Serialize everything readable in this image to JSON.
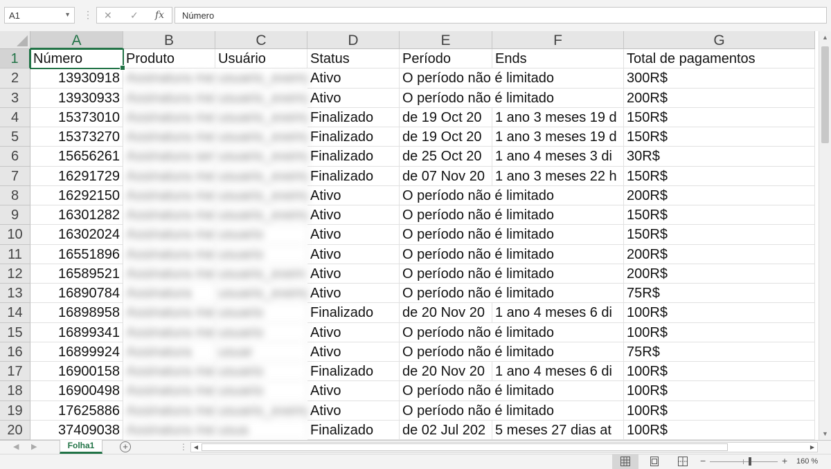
{
  "namebox": {
    "value": "A1"
  },
  "formula_bar": {
    "value": "Número",
    "cancel_symbol": "✕",
    "enter_symbol": "✓",
    "fx_label": "fx"
  },
  "columns": [
    "A",
    "B",
    "C",
    "D",
    "E",
    "F",
    "G"
  ],
  "rows": [
    {
      "n": "1",
      "a": "Número",
      "b": "Produto",
      "c": "Usuário",
      "d": "Status",
      "e": "Período",
      "f": "Ends",
      "g": "Total de pagamentos"
    },
    {
      "n": "2",
      "a": "13930918",
      "b": "Assinatura mensal plus",
      "c": "usuario_exemplo",
      "d": "Ativo",
      "e": "O período não é limitado",
      "f": "",
      "g": "300R$"
    },
    {
      "n": "3",
      "a": "13930933",
      "b": "Assinatura mensal plus",
      "c": "usuario_exemplo",
      "d": "Ativo",
      "e": "O período não é limitado",
      "f": "",
      "g": "200R$"
    },
    {
      "n": "4",
      "a": "15373010",
      "b": "Assinatura mensal",
      "c": "usuario_exemplo",
      "d": "Finalizado",
      "e": "de 19 Oct 20",
      "f": "1 ano 3 meses 19 d",
      "g": "150R$"
    },
    {
      "n": "5",
      "a": "15373270",
      "b": "Assinatura mensal",
      "c": "usuario_exemplo",
      "d": "Finalizado",
      "e": "de 19 Oct 20",
      "f": "1 ano 3 meses 19 d",
      "g": "150R$"
    },
    {
      "n": "6",
      "a": "15656261",
      "b": "Assinatura semanal",
      "c": "usuario_exemplo",
      "d": "Finalizado",
      "e": "de 25 Oct 20",
      "f": "1 ano 4 meses 3 di",
      "g": "30R$"
    },
    {
      "n": "7",
      "a": "16291729",
      "b": "Assinatura mensal",
      "c": "usuario_exemplo",
      "d": "Finalizado",
      "e": "de 07 Nov 20",
      "f": "1 ano 3 meses 22 h",
      "g": "150R$"
    },
    {
      "n": "8",
      "a": "16292150",
      "b": "Assinatura mensal plus",
      "c": "usuario_exemplo",
      "d": "Ativo",
      "e": "O período não é limitado",
      "f": "",
      "g": "200R$"
    },
    {
      "n": "9",
      "a": "16301282",
      "b": "Assinatura mensal",
      "c": "usuario_exemplo",
      "d": "Ativo",
      "e": "O período não é limitado",
      "f": "",
      "g": "150R$"
    },
    {
      "n": "10",
      "a": "16302024",
      "b": "Assinatura mensal",
      "c": "usuario",
      "d": "Ativo",
      "e": "O período não é limitado",
      "f": "",
      "g": "150R$"
    },
    {
      "n": "11",
      "a": "16551896",
      "b": "Assinatura mensal plus",
      "c": "usuario",
      "d": "Ativo",
      "e": "O período não é limitado",
      "f": "",
      "g": "200R$"
    },
    {
      "n": "12",
      "a": "16589521",
      "b": "Assinatura mensal plus",
      "c": "usuario_exem",
      "d": "Ativo",
      "e": "O período não é limitado",
      "f": "",
      "g": "200R$"
    },
    {
      "n": "13",
      "a": "16890784",
      "b": "Assinatura",
      "c": "usuario_exemplo",
      "d": "Ativo",
      "e": "O período não é limitado",
      "f": "",
      "g": "75R$"
    },
    {
      "n": "14",
      "a": "16898958",
      "b": "Assinatura mens",
      "c": "usuario",
      "d": "Finalizado",
      "e": "de 20 Nov 20",
      "f": "1 ano 4 meses 6 di",
      "g": "100R$"
    },
    {
      "n": "15",
      "a": "16899341",
      "b": "Assinatura mens",
      "c": "usuario",
      "d": "Ativo",
      "e": "O período não é limitado",
      "f": "",
      "g": "100R$"
    },
    {
      "n": "16",
      "a": "16899924",
      "b": "Assinatura",
      "c": "usuar",
      "d": "Ativo",
      "e": "O período não é limitado",
      "f": "",
      "g": "75R$"
    },
    {
      "n": "17",
      "a": "16900158",
      "b": "Assinatura mens",
      "c": "usuario",
      "d": "Finalizado",
      "e": "de 20 Nov 20",
      "f": "1 ano 4 meses 6 di",
      "g": "100R$"
    },
    {
      "n": "18",
      "a": "16900498",
      "b": "Assinatura mens",
      "c": "usuario",
      "d": "Ativo",
      "e": "O período não é limitado",
      "f": "",
      "g": "100R$"
    },
    {
      "n": "19",
      "a": "17625886",
      "b": "Assinatura mensal",
      "c": "usuario_exemplo",
      "d": "Ativo",
      "e": "O período não é limitado",
      "f": "",
      "g": "100R$"
    },
    {
      "n": "20",
      "a": "37409038",
      "b": "Assinatura mens",
      "c": "usua",
      "d": "Finalizado",
      "e": "de 02 Jul 202",
      "f": "5 meses 27 dias at",
      "g": "100R$"
    }
  ],
  "sheet_tab": {
    "label": "Folha1"
  },
  "status_bar": {
    "zoom_label": "160 %",
    "zoom_minus": "−",
    "zoom_plus": "+",
    "zoom_level_percent": 160
  },
  "colors": {
    "accent": "#217346",
    "header_bg": "#e6e6e6",
    "gridline": "#e1e1e1"
  }
}
